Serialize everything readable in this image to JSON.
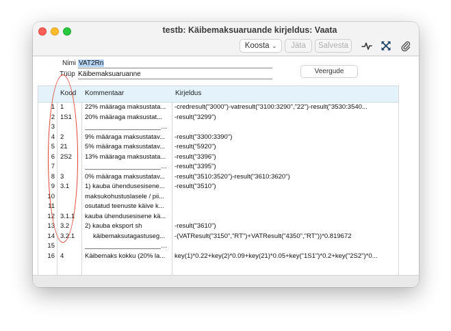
{
  "window": {
    "title": "testb: Käibemaksuaruande kirjeldus: Vaata"
  },
  "toolbar": {
    "koosta_label": "Koosta",
    "jata_label": "Jäta",
    "salvesta_label": "Salvesta",
    "icons": [
      "pulse-icon",
      "expand-icon",
      "paperclip-icon"
    ]
  },
  "form": {
    "nimi_label": "Nimi",
    "nimi_value": "VAT2Rn",
    "tyyp_label": "Tüüp",
    "tyyp_value": "Käibemaksuaruanne",
    "veergude_label": "Veergude"
  },
  "table": {
    "headers": {
      "kood": "Kood",
      "kommentaar": "Kommentaar",
      "kirjeldus": "Kirjeldus"
    },
    "rows": [
      {
        "num": "1",
        "kood": "1",
        "kommentaar": "22% määraga maksustata...",
        "kirjeldus": "-credresult(\"3000\")-vatresult(\"3100:3290\",\"22\")-result(\"3530:3540..."
      },
      {
        "num": "2",
        "kood": "1S1",
        "kommentaar": "20% määraga maksustat...",
        "kirjeldus": "-result(\"3299\")"
      },
      {
        "num": "3",
        "kood": "",
        "kommentaar": "________________________...",
        "kirjeldus": ""
      },
      {
        "num": "4",
        "kood": "2",
        "kommentaar": "9% määraga maksustatav...",
        "kirjeldus": "-result(\"3300:3390\")"
      },
      {
        "num": "5",
        "kood": "21",
        "kommentaar": "5% määraga maksustatav...",
        "kirjeldus": "-result(\"5920\")"
      },
      {
        "num": "6",
        "kood": "2S2",
        "kommentaar": "13% määraga maksustata...",
        "kirjeldus": "-result(\"3396\")"
      },
      {
        "num": "7",
        "kood": "",
        "kommentaar": "________________________...",
        "kirjeldus": "-result(\"3395\")"
      },
      {
        "num": "8",
        "kood": "3",
        "kommentaar": "0% määraga maksustatav...",
        "kirjeldus": "-result(\"3510:3520\")-result(\"3610:3620\")"
      },
      {
        "num": "9",
        "kood": "3.1",
        "kommentaar": "1) kauba ühendusesisene...",
        "kirjeldus": "-result(\"3510\")"
      },
      {
        "num": "10",
        "kood": "",
        "kommentaar": "maksukohustuslasele / pii...",
        "kirjeldus": ""
      },
      {
        "num": "11",
        "kood": "",
        "kommentaar": "osutatud teenuste käive k...",
        "kirjeldus": ""
      },
      {
        "num": "12",
        "kood": "3.1.1",
        "kommentaar": "kauba ühendusesisene kä...",
        "kirjeldus": ""
      },
      {
        "num": "13",
        "kood": "3.2",
        "kommentaar": "2) kauba eksport sh",
        "kirjeldus": "-result(\"3610\")"
      },
      {
        "num": "14",
        "kood": "3.2.1",
        "kommentaar": "käibemaksutagastuseg...",
        "kirjeldus": "-(VATResult(\"3150\",\"RT\")+VATResult(\"4350\",\"RT\"))*0.819672"
      },
      {
        "num": "15",
        "kood": "",
        "kommentaar": "________________________...",
        "kirjeldus": ""
      },
      {
        "num": "16",
        "kood": "4",
        "kommentaar": "Käibemaks kokku (20% la...",
        "kirjeldus": "key(1)*0.22+key(2)*0.09+key(21)*0.05+key(\"1S1\")*0.2+key(\"2S2\")*0..."
      }
    ]
  },
  "colors": {
    "header_bg": "#e3f2fb",
    "annotation_oval": "#e0402c",
    "selection": "#b5d4f5"
  }
}
